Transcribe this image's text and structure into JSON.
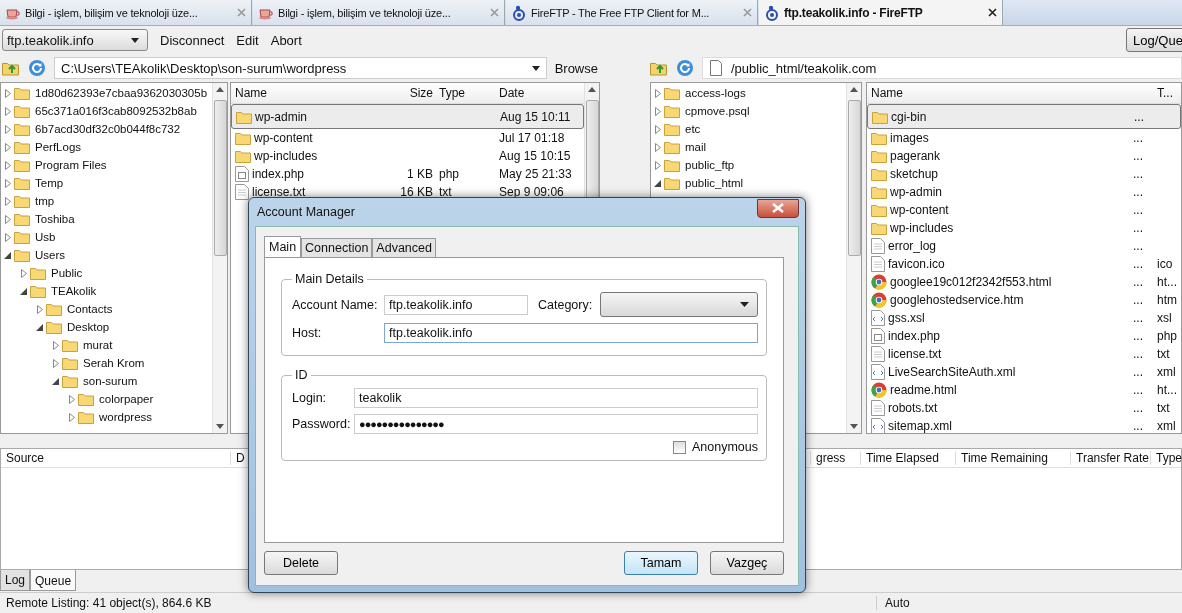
{
  "browser_tabs": [
    {
      "title": "Bilgi - işlem, bilişim ve teknoloji üze...",
      "kind": "blog",
      "selected": false
    },
    {
      "title": "Bilgi - işlem, bilişim ve teknoloji üze...",
      "kind": "blog",
      "selected": false
    },
    {
      "title": "FireFTP - The Free FTP Client for M...",
      "kind": "ftp",
      "selected": false
    },
    {
      "title": "ftp.teakolik.info - FireFTP",
      "kind": "ftp",
      "selected": true
    }
  ],
  "toolbar": {
    "account": "ftp.teakolik.info",
    "actions": [
      "Disconnect",
      "Edit",
      "Abort"
    ],
    "log_queue_button": "Log/Que"
  },
  "local": {
    "path": "C:\\Users\\TEAkolik\\Desktop\\son-surum\\wordpress",
    "browse": "Browse",
    "tree": [
      {
        "name": "1d80d62393e7cbaa9362030305b",
        "expanded": false
      },
      {
        "name": "65c371a016f3cab8092532b8ab",
        "expanded": false
      },
      {
        "name": "6b7acd30df32c0b044f8c732",
        "expanded": false
      },
      {
        "name": "PerfLogs",
        "expanded": false
      },
      {
        "name": "Program Files",
        "expanded": false
      },
      {
        "name": "Temp",
        "expanded": false
      },
      {
        "name": "tmp",
        "expanded": false
      },
      {
        "name": "Toshiba",
        "expanded": false
      },
      {
        "name": "Usb",
        "expanded": false
      },
      {
        "name": "Users",
        "expanded": true,
        "children": [
          {
            "name": "Public",
            "expanded": false
          },
          {
            "name": "TEAkolik",
            "expanded": true,
            "children": [
              {
                "name": "Contacts",
                "expanded": false
              },
              {
                "name": "Desktop",
                "expanded": true,
                "children": [
                  {
                    "name": "murat",
                    "expanded": false
                  },
                  {
                    "name": "Serah Krom",
                    "expanded": false
                  },
                  {
                    "name": "son-surum",
                    "expanded": true,
                    "children": [
                      {
                        "name": "colorpaper",
                        "expanded": false
                      },
                      {
                        "name": "wordpress",
                        "expanded": false
                      }
                    ]
                  }
                ]
              }
            ]
          }
        ]
      }
    ],
    "columns": [
      "Name",
      "Size",
      "Type",
      "Date"
    ],
    "files": [
      {
        "name": "wp-admin",
        "date": "Aug 15 10:11",
        "kind": "folder",
        "selected": true
      },
      {
        "name": "wp-content",
        "date": "Jul 17 01:18",
        "kind": "folder",
        "selected": false
      },
      {
        "name": "wp-includes",
        "date": "Aug 15 10:15",
        "kind": "folder",
        "selected": false
      },
      {
        "name": "index.php",
        "size": "1 KB",
        "type": "php",
        "date": "May 25 21:33",
        "kind": "script",
        "selected": false
      },
      {
        "name": "license.txt",
        "size": "16 KB",
        "type": "txt",
        "date": "Sep 9 09:06",
        "kind": "text",
        "selected": false
      }
    ]
  },
  "remote": {
    "path": "/public_html/teakolik.com",
    "tree": [
      {
        "name": "access-logs",
        "expanded": false
      },
      {
        "name": "cpmove.psql",
        "expanded": false
      },
      {
        "name": "etc",
        "expanded": false
      },
      {
        "name": "mail",
        "expanded": false
      },
      {
        "name": "public_ftp",
        "expanded": false
      },
      {
        "name": "public_html",
        "expanded": true
      }
    ],
    "columns": [
      "Name",
      "T..."
    ],
    "files": [
      {
        "name": "cgi-bin",
        "size": "...",
        "kind": "folder",
        "selected": true
      },
      {
        "name": "images",
        "size": "...",
        "kind": "folder",
        "selected": false
      },
      {
        "name": "pagerank",
        "size": "...",
        "kind": "folder",
        "selected": false
      },
      {
        "name": "sketchup",
        "size": "...",
        "kind": "folder",
        "selected": false
      },
      {
        "name": "wp-admin",
        "size": "...",
        "kind": "folder",
        "selected": false
      },
      {
        "name": "wp-content",
        "size": "...",
        "kind": "folder",
        "selected": false
      },
      {
        "name": "wp-includes",
        "size": "...",
        "kind": "folder",
        "selected": false
      },
      {
        "name": "error_log",
        "size": "...",
        "kind": "text",
        "selected": false
      },
      {
        "name": "favicon.ico",
        "size": "...",
        "type": "ico",
        "kind": "text",
        "selected": false
      },
      {
        "name": "googlee19c012f2342f553.html",
        "size": "...",
        "type": "ht...",
        "kind": "web",
        "selected": false
      },
      {
        "name": "googlehostedservice.htm",
        "size": "...",
        "type": "htm",
        "kind": "web",
        "selected": false
      },
      {
        "name": "gss.xsl",
        "size": "...",
        "type": "xsl",
        "kind": "code",
        "selected": false
      },
      {
        "name": "index.php",
        "size": "...",
        "type": "php",
        "kind": "script",
        "selected": false
      },
      {
        "name": "license.txt",
        "size": "...",
        "type": "txt",
        "kind": "text",
        "selected": false
      },
      {
        "name": "LiveSearchSiteAuth.xml",
        "size": "...",
        "type": "xml",
        "kind": "code",
        "selected": false
      },
      {
        "name": "readme.html",
        "size": "...",
        "type": "ht...",
        "kind": "web",
        "selected": false
      },
      {
        "name": "robots.txt",
        "size": "...",
        "type": "txt",
        "kind": "text",
        "selected": false
      },
      {
        "name": "sitemap.xml",
        "size": "...",
        "type": "xml",
        "kind": "code",
        "selected": false
      }
    ]
  },
  "queue": {
    "columns": [
      {
        "label": "Source",
        "kind": "source"
      },
      {
        "label": "D",
        "kind": "dest"
      },
      {
        "label": "gress",
        "kind": "progress"
      },
      {
        "label": "Time Elapsed",
        "kind": "elapsed"
      },
      {
        "label": "Time Remaining",
        "kind": "remaining"
      },
      {
        "label": "Transfer Rate",
        "kind": "rate"
      },
      {
        "label": "Type",
        "kind": "type"
      }
    ]
  },
  "bottom_tabs": [
    {
      "label": "Log",
      "selected": false
    },
    {
      "label": "Queue",
      "selected": true
    }
  ],
  "status_bar": {
    "listing": "Remote Listing: 41 object(s), 864.6 KB",
    "mode": "Auto"
  },
  "dialog": {
    "title": "Account Manager",
    "tabs": [
      {
        "label": "Main",
        "selected": true
      },
      {
        "label": "Connection",
        "selected": false
      },
      {
        "label": "Advanced",
        "selected": false
      }
    ],
    "main_details": {
      "legend": "Main Details",
      "account_name_label": "Account Name:",
      "account_name": "ftp.teakolik.info",
      "category_label": "Category:",
      "host_label": "Host:",
      "host": "ftp.teakolik.info"
    },
    "id": {
      "legend": "ID",
      "login_label": "Login:",
      "login": "teakolik",
      "password_label": "Password:",
      "password_mask": "●●●●●●●●●●●●●●●",
      "anonymous_label": "Anonymous",
      "anonymous": false
    },
    "buttons": [
      {
        "label": "Delete",
        "kind": "left",
        "default": false
      },
      {
        "label": "Tamam",
        "kind": "right",
        "default": true
      },
      {
        "label": "Vazgeç",
        "kind": "right",
        "default": false
      }
    ]
  }
}
